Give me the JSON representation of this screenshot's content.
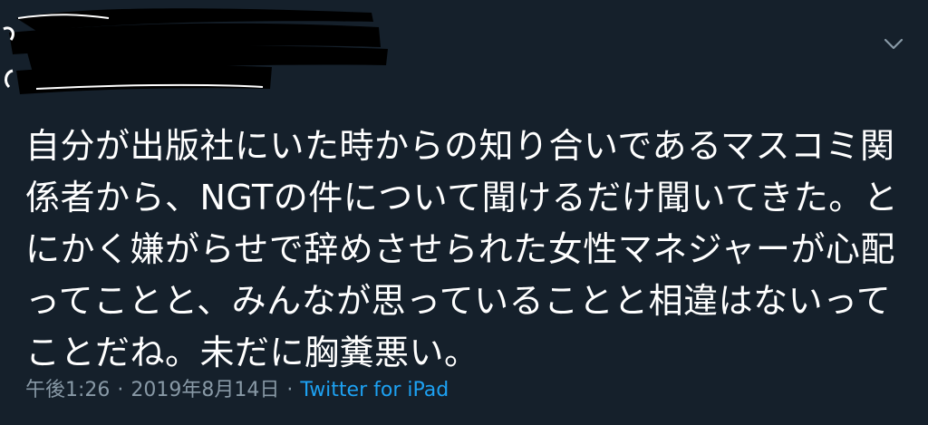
{
  "tweet": {
    "text": "自分が出版社にいた時からの知り合いであるマスコミ関係者から、NGTの件について聞けるだけ聞いてきた。とにかく嫌がらせで辞めさせられた女性マネジャーが心配ってことと、みんなが思っていることと相違はないってことだね。未だに胸糞悪い。",
    "time": "午後1:26",
    "separator": "·",
    "date": "2019年8月14日",
    "source": "Twitter for iPad"
  },
  "icons": {
    "menu": "chevron-down-icon",
    "redaction": "redaction-scribble"
  },
  "colors": {
    "background": "#15202b",
    "text": "#ffffff",
    "meta": "#8899a6",
    "link": "#1da1f2",
    "chevron": "#8899a6"
  }
}
